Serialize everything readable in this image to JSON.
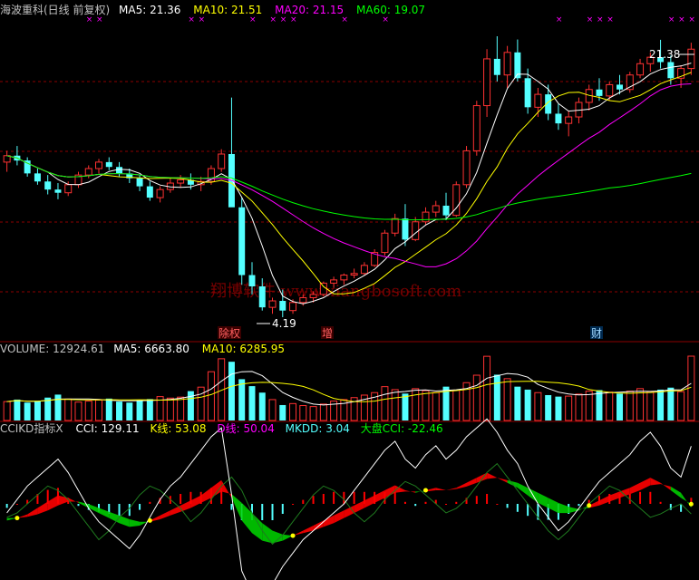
{
  "header": {
    "title": "海波重科(日线 前复权)",
    "ma5": "MA5: 21.36",
    "ma10": "MA10: 21.51",
    "ma20": "MA20: 21.15",
    "ma60": "MA60: 19.07"
  },
  "volume_header": {
    "volume": "VOLUME: 12924.61",
    "ma5": "MA5: 6663.80",
    "ma10": "MA10: 6285.95"
  },
  "indicator_header": {
    "name": "CCIKD指标X",
    "cci": "CCI: 129.11",
    "k": "K线: 53.08",
    "d": "D线: 50.04",
    "mkdd": "MKDD: 3.04",
    "market_cci": "大盘CCI: -22.46"
  },
  "annotations": {
    "high_price": "21.38",
    "low_price": "4.19",
    "watermark": "翔博软件 www.xiangbosoft.com",
    "badge_1": "除权",
    "badge_2": "增",
    "badge_3": "财"
  },
  "colors": {
    "up": "#ff3232",
    "down": "#54ffff",
    "ma5": "#ffffff",
    "ma10": "#ffff00",
    "ma20": "#ff00ff",
    "ma60": "#00ff00",
    "ccikd_up": "#ff0000",
    "ccikd_down": "#00cc00",
    "grid": "#8b0000"
  },
  "chart_data": {
    "type": "candlestick",
    "price_series": {
      "ohlc": [
        [
          13.8,
          14.5,
          13.2,
          14.2
        ],
        [
          14.2,
          14.8,
          13.6,
          13.9
        ],
        [
          13.9,
          14.1,
          12.9,
          13.1
        ],
        [
          13.1,
          13.4,
          12.4,
          12.6
        ],
        [
          12.6,
          13.0,
          11.8,
          12.1
        ],
        [
          12.1,
          12.5,
          11.5,
          11.9
        ],
        [
          11.9,
          12.6,
          11.7,
          12.4
        ],
        [
          12.4,
          13.2,
          12.2,
          13.0
        ],
        [
          13.0,
          13.6,
          12.8,
          13.4
        ],
        [
          13.4,
          14.0,
          13.1,
          13.8
        ],
        [
          13.8,
          14.1,
          13.3,
          13.5
        ],
        [
          13.5,
          13.8,
          12.9,
          13.1
        ],
        [
          13.1,
          13.4,
          12.5,
          12.8
        ],
        [
          12.8,
          13.0,
          12.0,
          12.3
        ],
        [
          12.3,
          12.6,
          11.4,
          11.6
        ],
        [
          11.6,
          12.3,
          11.3,
          12.1
        ],
        [
          12.1,
          12.8,
          11.9,
          12.5
        ],
        [
          12.5,
          13.0,
          12.2,
          12.7
        ],
        [
          12.7,
          13.1,
          12.1,
          12.4
        ],
        [
          12.4,
          12.9,
          12.0,
          12.6
        ],
        [
          12.6,
          13.6,
          12.4,
          13.4
        ],
        [
          13.4,
          14.6,
          13.2,
          14.3
        ],
        [
          14.3,
          17.8,
          13.8,
          11.0
        ],
        [
          11.0,
          11.6,
          6.2,
          6.8
        ],
        [
          6.8,
          7.6,
          5.6,
          6.1
        ],
        [
          6.1,
          6.6,
          4.6,
          4.8
        ],
        [
          4.8,
          5.4,
          4.4,
          5.2
        ],
        [
          5.2,
          5.9,
          4.19,
          4.6
        ],
        [
          4.6,
          5.3,
          4.4,
          5.1
        ],
        [
          5.1,
          5.6,
          4.9,
          5.4
        ],
        [
          5.4,
          5.8,
          5.1,
          5.6
        ],
        [
          5.6,
          6.4,
          5.5,
          6.3
        ],
        [
          6.3,
          6.7,
          6.0,
          6.5
        ],
        [
          6.5,
          6.9,
          6.2,
          6.8
        ],
        [
          6.8,
          7.2,
          6.6,
          6.9
        ],
        [
          6.9,
          7.6,
          6.8,
          7.4
        ],
        [
          7.4,
          8.4,
          7.3,
          8.2
        ],
        [
          8.2,
          9.6,
          8.0,
          9.4
        ],
        [
          9.4,
          10.6,
          9.2,
          10.3
        ],
        [
          10.3,
          11.2,
          8.6,
          9.0
        ],
        [
          9.0,
          10.4,
          8.9,
          10.1
        ],
        [
          10.1,
          11.0,
          9.9,
          10.7
        ],
        [
          10.7,
          11.4,
          10.4,
          11.1
        ],
        [
          11.1,
          11.9,
          10.2,
          10.5
        ],
        [
          10.5,
          12.6,
          10.4,
          12.4
        ],
        [
          12.4,
          14.8,
          12.2,
          14.5
        ],
        [
          14.5,
          17.6,
          14.2,
          17.3
        ],
        [
          17.3,
          20.8,
          16.6,
          20.2
        ],
        [
          20.2,
          21.6,
          18.8,
          19.2
        ],
        [
          19.2,
          21.0,
          18.4,
          20.6
        ],
        [
          20.6,
          21.4,
          18.8,
          19.0
        ],
        [
          19.0,
          19.6,
          16.8,
          17.2
        ],
        [
          17.2,
          18.4,
          16.6,
          18.0
        ],
        [
          18.0,
          18.6,
          16.4,
          16.8
        ],
        [
          16.8,
          17.4,
          15.8,
          16.2
        ],
        [
          16.2,
          17.0,
          15.4,
          16.6
        ],
        [
          16.6,
          17.8,
          16.2,
          17.5
        ],
        [
          17.5,
          18.6,
          17.0,
          18.3
        ],
        [
          18.3,
          19.0,
          17.6,
          17.9
        ],
        [
          17.9,
          18.8,
          17.6,
          18.6
        ],
        [
          18.6,
          19.2,
          18.0,
          18.3
        ],
        [
          18.3,
          19.4,
          18.1,
          19.2
        ],
        [
          19.2,
          20.2,
          19.0,
          19.9
        ],
        [
          19.9,
          20.6,
          19.4,
          20.3
        ],
        [
          20.3,
          21.38,
          19.6,
          20.0
        ],
        [
          20.0,
          20.4,
          18.6,
          19.0
        ],
        [
          19.0,
          19.8,
          18.4,
          19.6
        ],
        [
          19.6,
          21.2,
          19.2,
          20.8
        ]
      ]
    },
    "ma_lines": [
      "MA5",
      "MA10",
      "MA20",
      "MA60"
    ],
    "volume_series": {
      "values": [
        3800,
        4200,
        3600,
        3900,
        4600,
        5200,
        4300,
        3700,
        3900,
        4100,
        4400,
        3800,
        3600,
        4000,
        4300,
        4800,
        4500,
        4700,
        5900,
        6700,
        9800,
        12400,
        11800,
        8300,
        6900,
        5600,
        4200,
        3100,
        3400,
        3000,
        2800,
        3300,
        3900,
        4200,
        4600,
        5100,
        5600,
        6800,
        6200,
        5400,
        6400,
        6000,
        5600,
        6800,
        6100,
        7600,
        9100,
        12900,
        9200,
        8400,
        6800,
        6200,
        5600,
        5100,
        4800,
        4900,
        5300,
        5900,
        6100,
        5700,
        5400,
        5900,
        6400,
        5800,
        6200,
        6600,
        5800,
        12924.61
      ]
    },
    "ccikd_series": {
      "cci": [
        -20,
        10,
        40,
        60,
        80,
        100,
        70,
        30,
        -10,
        -40,
        -60,
        -80,
        -100,
        -70,
        -30,
        10,
        40,
        60,
        90,
        120,
        150,
        170,
        20,
        -150,
        -200,
        -220,
        -180,
        -140,
        -110,
        -80,
        -60,
        -40,
        -20,
        0,
        30,
        60,
        90,
        120,
        140,
        100,
        80,
        110,
        130,
        100,
        120,
        150,
        170,
        190,
        160,
        120,
        90,
        40,
        0,
        -30,
        -60,
        -40,
        -10,
        20,
        50,
        70,
        90,
        110,
        140,
        160,
        129.11,
        80,
        60,
        129.11
      ],
      "k": [
        40,
        42,
        45,
        50,
        55,
        60,
        58,
        54,
        50,
        46,
        42,
        38,
        35,
        36,
        40,
        44,
        48,
        52,
        56,
        60,
        66,
        72,
        58,
        40,
        30,
        24,
        22,
        24,
        28,
        32,
        36,
        40,
        44,
        48,
        52,
        56,
        60,
        64,
        68,
        64,
        62,
        64,
        66,
        64,
        66,
        70,
        74,
        78,
        74,
        70,
        66,
        60,
        54,
        50,
        46,
        46,
        48,
        52,
        56,
        60,
        63,
        66,
        70,
        74,
        70,
        64,
        58,
        53.08
      ],
      "d": [
        42,
        42,
        43,
        45,
        48,
        52,
        55,
        55,
        53,
        50,
        47,
        44,
        41,
        39,
        39,
        41,
        44,
        47,
        50,
        54,
        58,
        63,
        61,
        54,
        46,
        38,
        32,
        29,
        28,
        30,
        32,
        35,
        38,
        42,
        46,
        50,
        54,
        58,
        62,
        63,
        63,
        63,
        64,
        64,
        65,
        67,
        70,
        73,
        74,
        72,
        70,
        66,
        62,
        58,
        54,
        51,
        49,
        50,
        52,
        55,
        58,
        61,
        64,
        68,
        69,
        67,
        62,
        50.04
      ],
      "market_cci": [
        -30,
        -20,
        0,
        20,
        40,
        30,
        10,
        -20,
        -50,
        -80,
        -60,
        -30,
        -10,
        20,
        40,
        30,
        10,
        -10,
        -40,
        -20,
        10,
        40,
        60,
        30,
        -20,
        -60,
        -90,
        -70,
        -40,
        -10,
        20,
        40,
        30,
        10,
        -20,
        -40,
        -20,
        10,
        30,
        50,
        40,
        20,
        0,
        -20,
        -10,
        10,
        40,
        70,
        90,
        60,
        30,
        0,
        -30,
        -60,
        -80,
        -60,
        -30,
        0,
        20,
        40,
        30,
        10,
        -10,
        -30,
        -22.46,
        -10,
        0,
        -22.46
      ]
    }
  }
}
